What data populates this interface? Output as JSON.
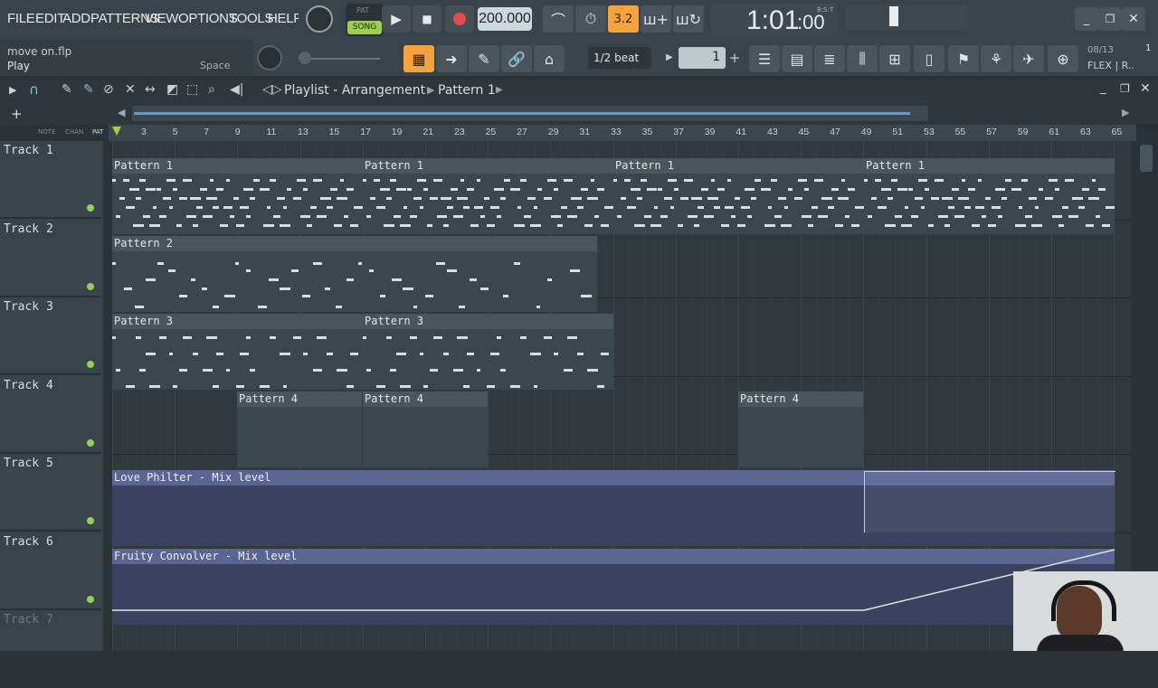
{
  "menu": [
    "FILE",
    "EDIT",
    "ADD",
    "PATTERNS",
    "VIEW",
    "OPTIONS",
    "TOOLS",
    "HELP"
  ],
  "transport": {
    "pat": "PAT",
    "song": "SONG",
    "tempo": "200.000",
    "time": "1:01",
    "time_sub": ":00",
    "time_unit": "B:S:T",
    "beat_fraction": "3.2"
  },
  "hint": {
    "file": "move on.flp",
    "action": "Play",
    "shortcut": "Space"
  },
  "snap": {
    "label": "1/2 beat",
    "step": "1"
  },
  "cpu": {
    "date": "08/13",
    "label": "FLEX | R..",
    "badge": "1"
  },
  "playlist": {
    "title": "Playlist - Arrangement",
    "pattern": "Pattern 1",
    "browser_tabs": [
      "NOTE",
      "CHAN",
      "PAT"
    ]
  },
  "ruler": [
    "3",
    "5",
    "7",
    "9",
    "11",
    "13",
    "15",
    "17",
    "19",
    "21",
    "23",
    "25",
    "27",
    "29",
    "31",
    "33",
    "35",
    "37",
    "39",
    "41",
    "43",
    "45",
    "47",
    "49",
    "51",
    "53",
    "55",
    "57",
    "59",
    "61",
    "63",
    "65"
  ],
  "tracks": [
    "Track 1",
    "Track 2",
    "Track 3",
    "Track 4",
    "Track 5",
    "Track 6",
    "Track 7"
  ],
  "clips": {
    "p1": "Pattern 1",
    "p2": "Pattern 2",
    "p3": "Pattern 3",
    "p4": "Pattern 4",
    "auto1": "Love Philter - Mix level",
    "auto2": "Fruity Convolver - Mix level"
  },
  "colors": {
    "accent": "#f7a23b",
    "led": "#8fd35a",
    "automation": "#5a6592"
  }
}
